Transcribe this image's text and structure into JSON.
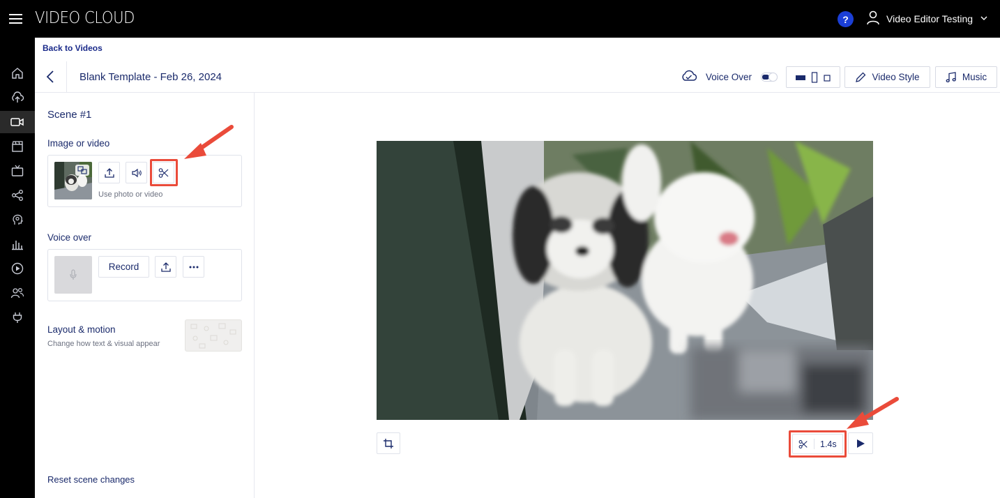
{
  "header": {
    "brand": "VIDEO CLOUD",
    "help_label": "?",
    "user_name": "Video Editor Testing"
  },
  "nav": {
    "items": [
      "home-icon",
      "upload-icon",
      "video-camera-icon",
      "clapperboard-icon",
      "tv-icon",
      "share-icon",
      "head-brain-icon",
      "analytics-icon",
      "play-circle-icon",
      "users-icon",
      "plug-icon"
    ],
    "active_index": 2
  },
  "breadcrumb": {
    "back_label": "Back to Videos"
  },
  "titlebar": {
    "project_title": "Blank Template - Feb 26, 2024",
    "voice_over_label": "Voice Over",
    "voice_over_enabled": true,
    "video_style_label": "Video Style",
    "music_label": "Music"
  },
  "scene": {
    "title": "Scene #1",
    "image_section_label": "Image or video",
    "image_hint": "Use photo or video",
    "voice_section_label": "Voice over",
    "record_label": "Record",
    "layout_title": "Layout & motion",
    "layout_subtitle": "Change how text & visual appear",
    "reset_label": "Reset scene changes"
  },
  "player": {
    "trim_duration": "1.4s"
  },
  "colors": {
    "accent": "#1a2a6b",
    "annotation": "#ea4b3a",
    "help_badge": "#1b3fd6"
  }
}
